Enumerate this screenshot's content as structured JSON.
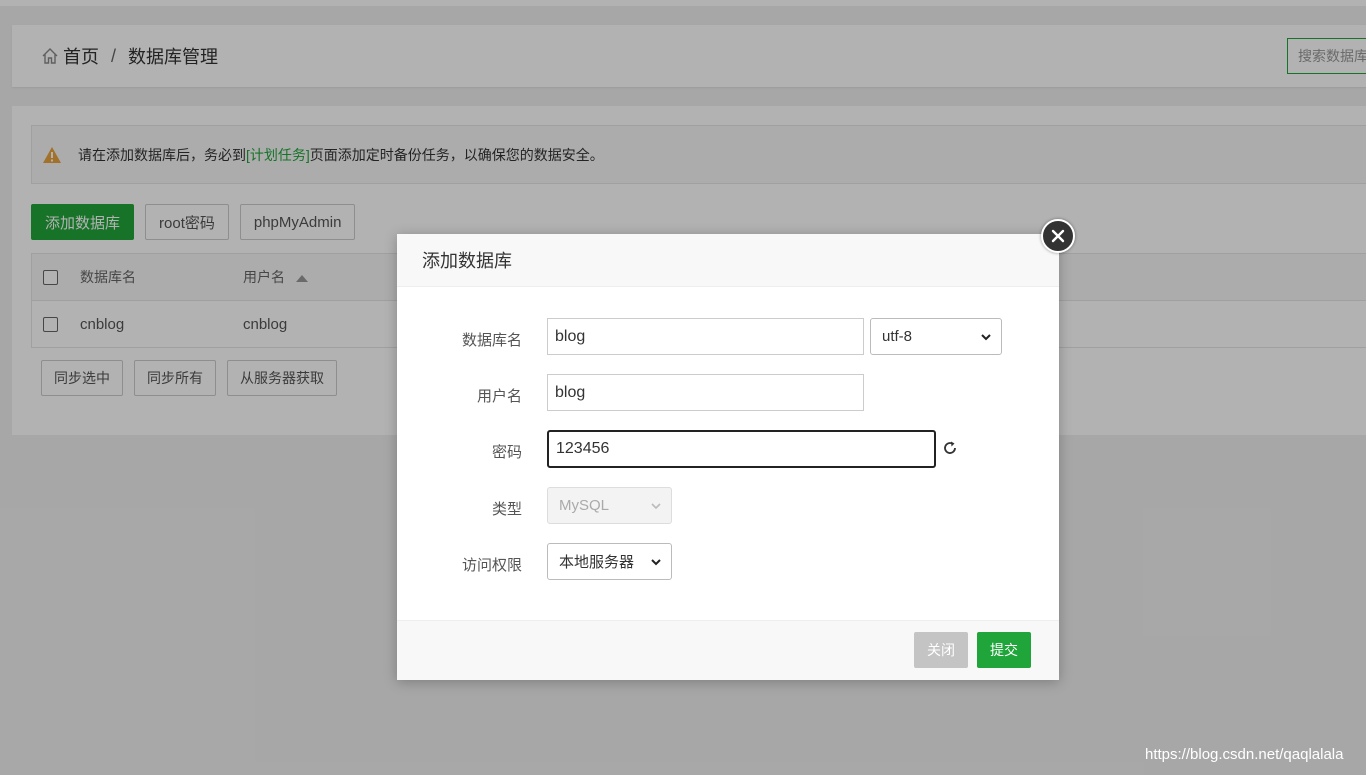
{
  "header": {
    "home_label": "首页",
    "separator": "/",
    "page_title": "数据库管理",
    "search_placeholder": "搜索数据库"
  },
  "notice": {
    "text_before": "请在添加数据库后，务必到",
    "link_text": "[计划任务]",
    "text_after": "页面添加定时备份任务，以确保您的数据安全。"
  },
  "toolbar": {
    "add_db_label": "添加数据库",
    "root_pwd_label": "root密码",
    "phpmyadmin_label": "phpMyAdmin"
  },
  "table": {
    "headers": [
      "数据库名",
      "用户名"
    ],
    "rows": [
      {
        "name": "cnblog",
        "user": "cnblog"
      }
    ]
  },
  "bottom_actions": {
    "sync_selected": "同步选中",
    "sync_all": "同步所有",
    "fetch_server": "从服务器获取"
  },
  "modal": {
    "title": "添加数据库",
    "fields": {
      "db_name_label": "数据库名",
      "db_name_value": "blog",
      "charset_value": "utf-8",
      "username_label": "用户名",
      "username_value": "blog",
      "password_label": "密码",
      "password_value": "123456",
      "type_label": "类型",
      "type_value": "MySQL",
      "access_label": "访问权限",
      "access_value": "本地服务器"
    },
    "close_label": "关闭",
    "submit_label": "提交"
  },
  "watermark": "https://blog.csdn.net/qaqlalala",
  "colors": {
    "brand_green": "#20a53a",
    "warning_orange": "#e8a33d"
  }
}
